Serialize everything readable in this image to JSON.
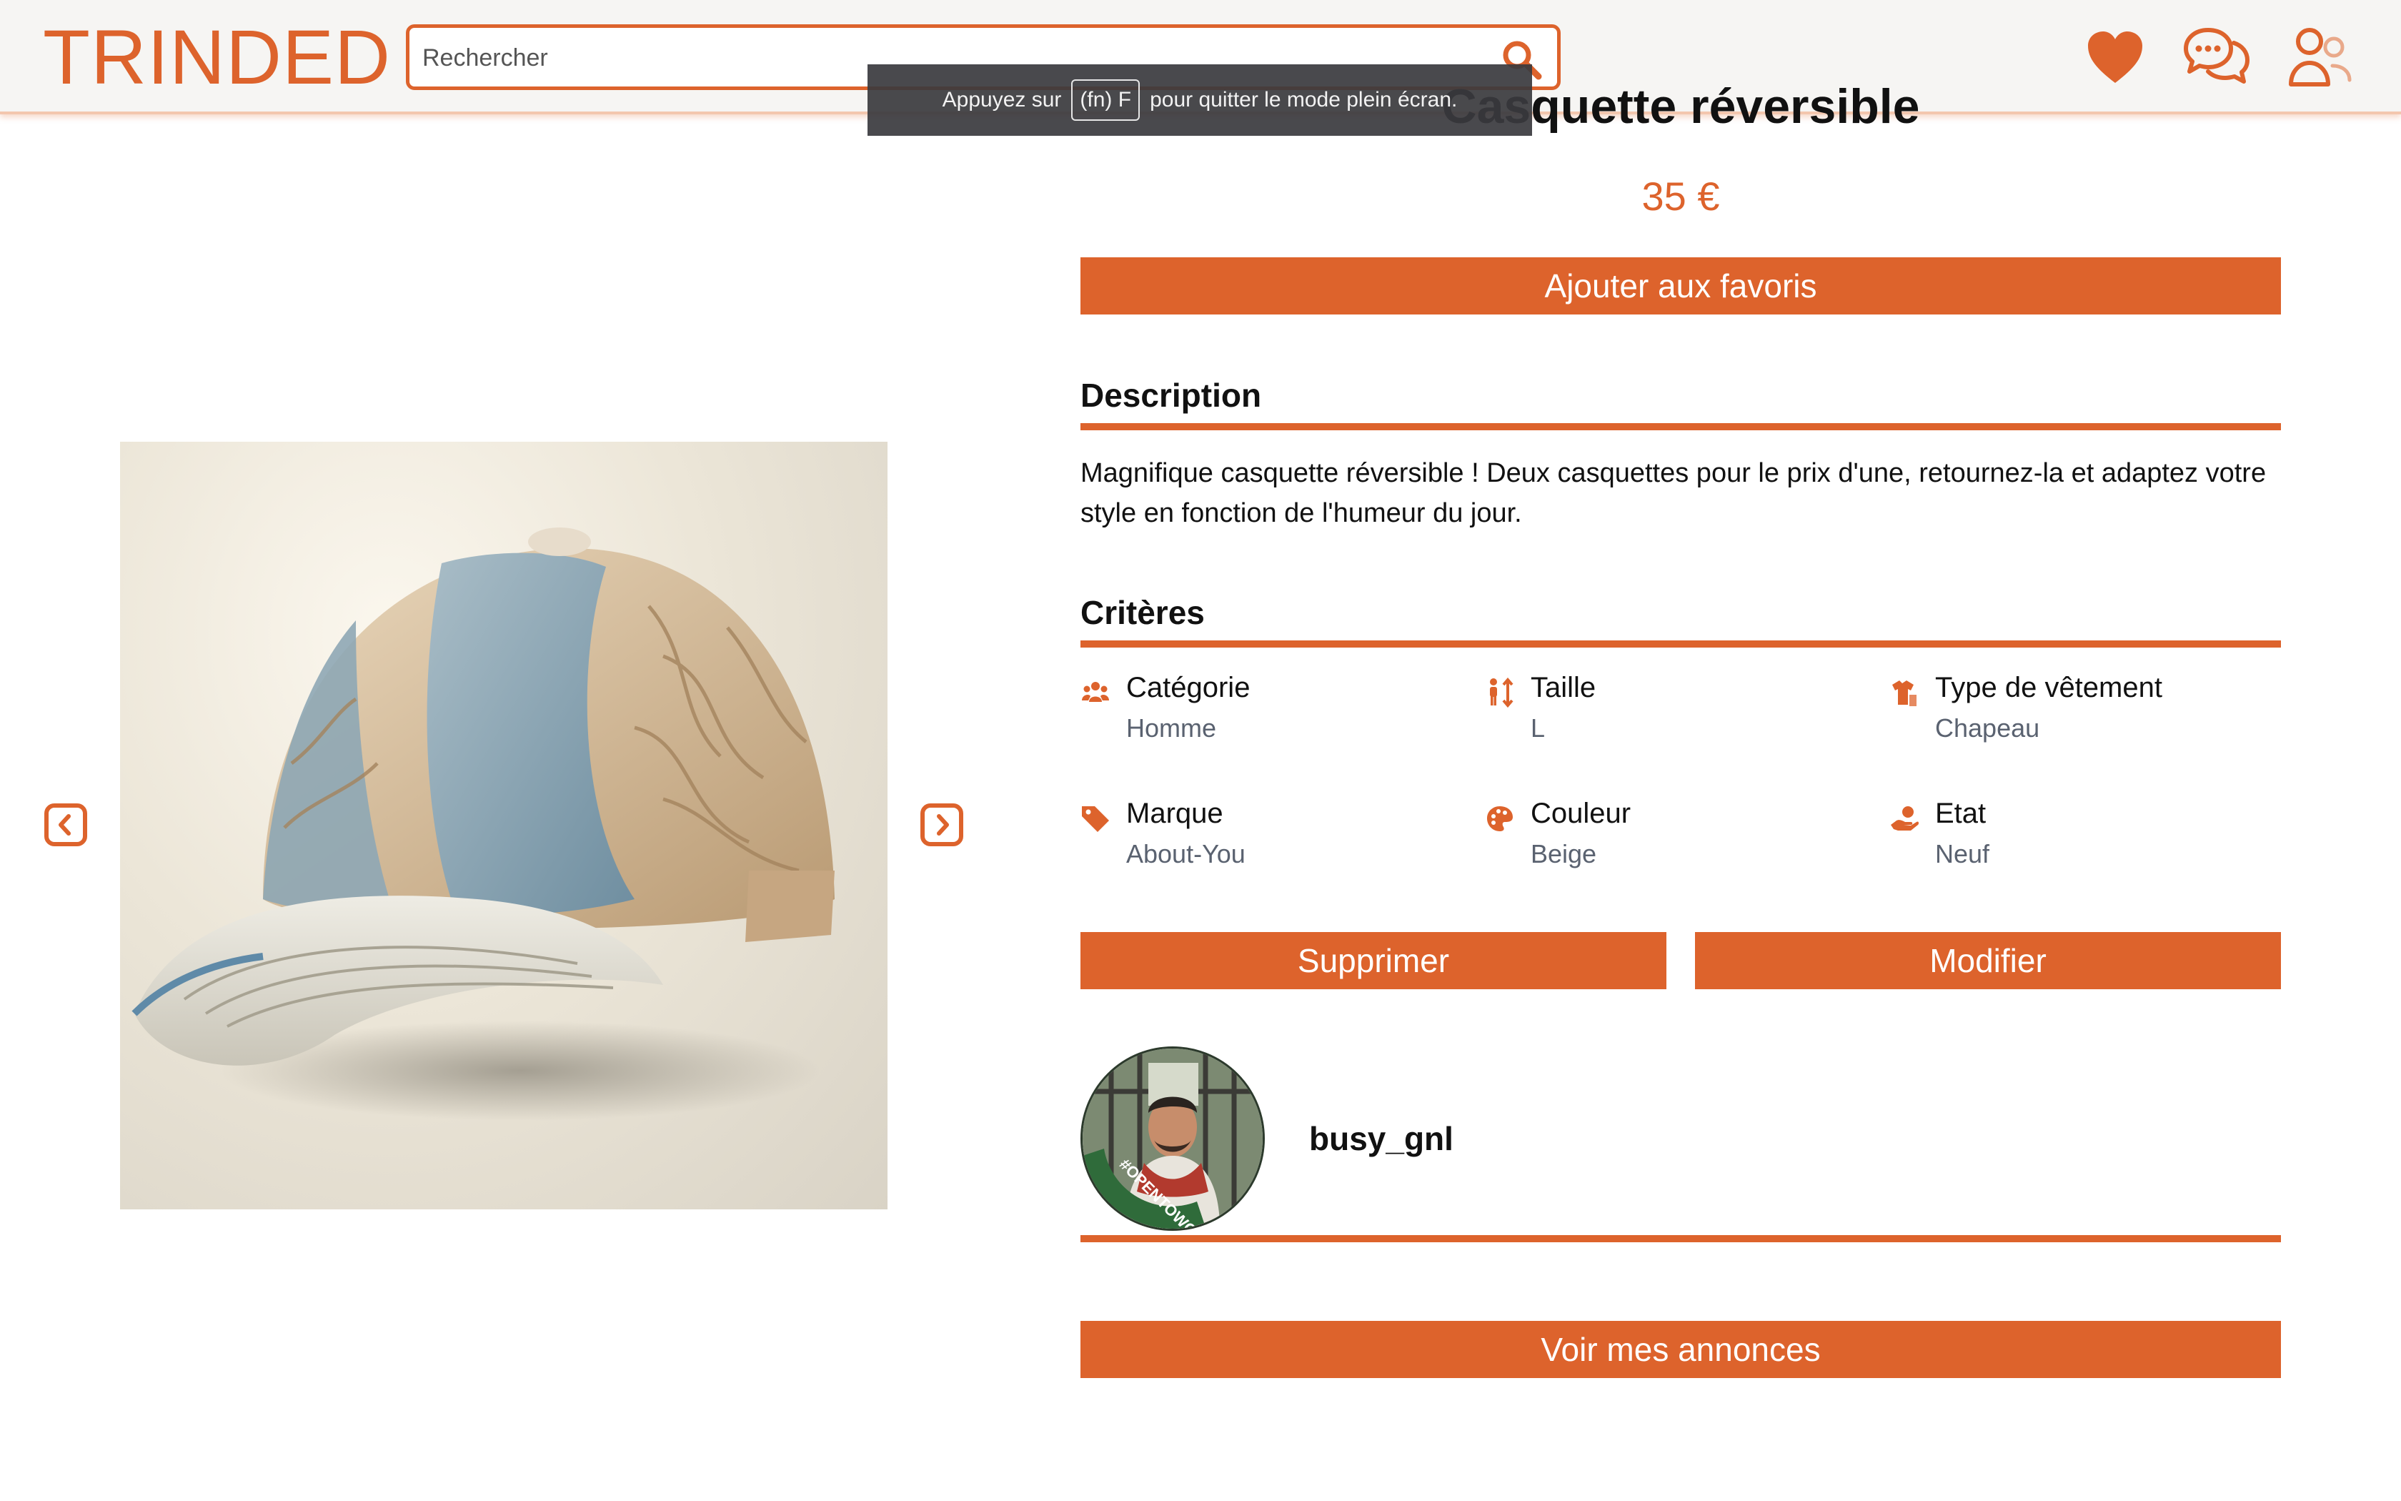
{
  "header": {
    "logo": "TRINDED",
    "search_placeholder": "Rechercher",
    "icons": [
      "search-icon",
      "heart-icon",
      "chat-icon",
      "user-icon"
    ]
  },
  "fullscreen_tip": {
    "before": "Appuyez sur",
    "key": "(fn) F",
    "after": "pour quitter le mode plein écran."
  },
  "product": {
    "title": "Casquette réversible",
    "price": "35 €",
    "favorite_button": "Ajouter aux favoris",
    "description_heading": "Description",
    "description": "Magnifique casquette réversible ! Deux casquettes pour le prix d'une, retournez-la et adaptez votre style en fonction de l'humeur du jour.",
    "criteria_heading": "Critères",
    "criteria": [
      {
        "label": "Catégorie",
        "value": "Homme",
        "icon": "people-icon"
      },
      {
        "label": "Taille",
        "value": "L",
        "icon": "size-icon"
      },
      {
        "label": "Type de vêtement",
        "value": "Chapeau",
        "icon": "shirt-icon"
      },
      {
        "label": "Marque",
        "value": "About-You",
        "icon": "tag-icon"
      },
      {
        "label": "Couleur",
        "value": "Beige",
        "icon": "palette-icon"
      },
      {
        "label": "Etat",
        "value": "Neuf",
        "icon": "hand-icon"
      }
    ],
    "delete_button": "Supprimer",
    "edit_button": "Modifier"
  },
  "seller": {
    "username": "busy_gnl",
    "badge_text": "#OPENTOWORK",
    "ads_button": "Voir mes annonces"
  },
  "colors": {
    "accent": "#dd632c",
    "header_bg": "#f6f5f3",
    "muted_text": "#5a6270"
  }
}
